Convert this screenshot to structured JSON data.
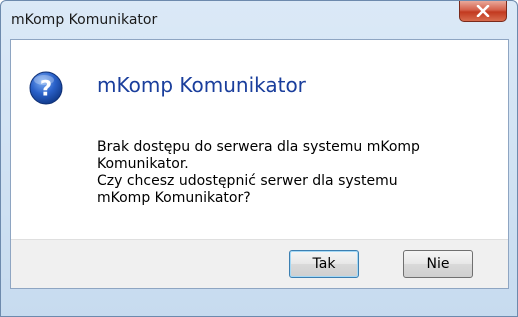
{
  "window": {
    "title": "mKomp Komunikator"
  },
  "dialog": {
    "icon": "question-icon",
    "heading": "mKomp Komunikator",
    "message_lines": [
      "Brak dostępu do serwera dla systemu mKomp",
      "Komunikator.",
      "Czy chcesz udostępnić serwer dla systemu",
      "mKomp Komunikator?"
    ]
  },
  "buttons": {
    "yes_label": "Tak",
    "no_label": "Nie"
  },
  "colors": {
    "heading": "#1a3e9c",
    "close_button": "#c2391f",
    "frame": "#c7dbef"
  }
}
